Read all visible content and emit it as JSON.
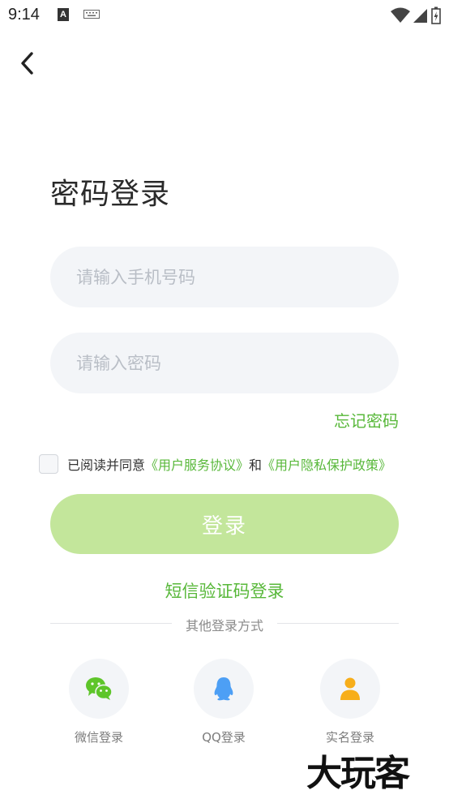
{
  "status_bar": {
    "time": "9:14"
  },
  "title": "密码登录",
  "phone_input": {
    "placeholder": "请输入手机号码"
  },
  "password_input": {
    "placeholder": "请输入密码"
  },
  "forgot_password": "忘记密码",
  "agreement": {
    "prefix": "已阅读并同意",
    "service_link": "《用户服务协议》",
    "conjunction": "和",
    "privacy_link": "《用户隐私保护政策》"
  },
  "login_button": "登录",
  "sms_login": "短信验证码登录",
  "other_methods": "其他登录方式",
  "social": [
    {
      "label": "微信登录",
      "icon": "wechat-icon"
    },
    {
      "label": "QQ登录",
      "icon": "qq-icon"
    },
    {
      "label": "实名登录",
      "icon": "person-icon"
    }
  ],
  "watermark": "大玩客",
  "colors": {
    "accent": "#58b83a",
    "button_disabled": "#c3e69b",
    "input_bg": "#f3f5f8",
    "wechat": "#5ec52a",
    "qq": "#4d9ff5",
    "person": "#f7ae1a"
  }
}
